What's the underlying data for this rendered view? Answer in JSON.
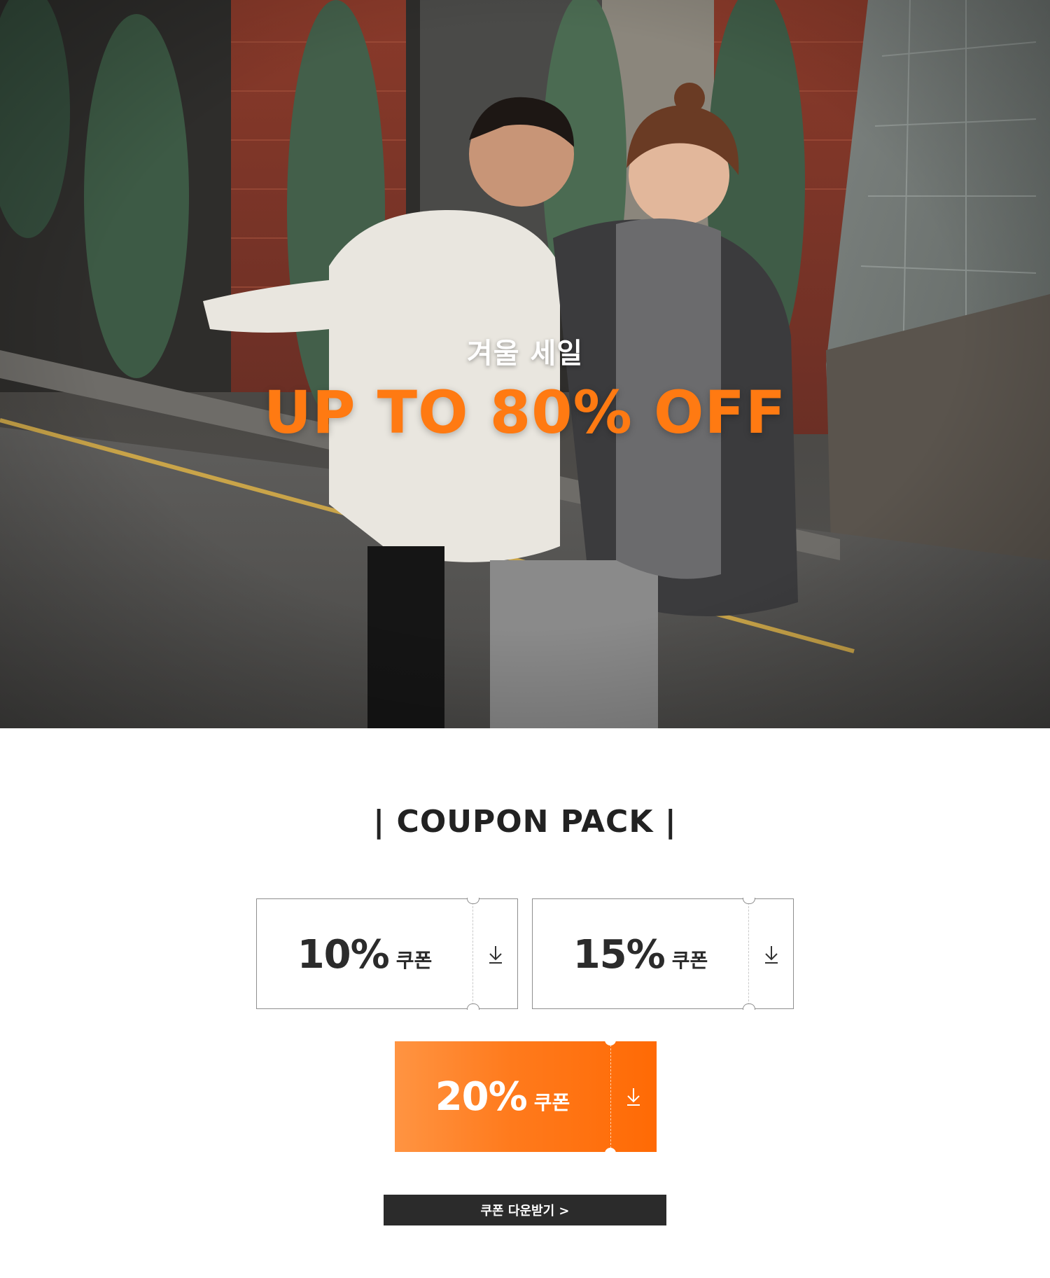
{
  "hero": {
    "subtitle": "겨울 세일",
    "title": "UP TO 80% OFF",
    "title_color": "#ff7a12"
  },
  "coupon_section": {
    "title": "| COUPON PACK |"
  },
  "coupons": [
    {
      "percent": "10%",
      "unit": "쿠폰",
      "icon": "download-icon",
      "style": "outline"
    },
    {
      "percent": "15%",
      "unit": "쿠폰",
      "icon": "download-icon",
      "style": "outline"
    },
    {
      "percent": "20%",
      "unit": "쿠폰",
      "icon": "download-icon",
      "style": "orange"
    }
  ],
  "download_button": {
    "label": "쿠폰 다운받기 >"
  },
  "colors": {
    "accent_orange": "#ff7a12",
    "dark_button": "#2b2b2b",
    "coupon_border": "#8e8e8e"
  }
}
